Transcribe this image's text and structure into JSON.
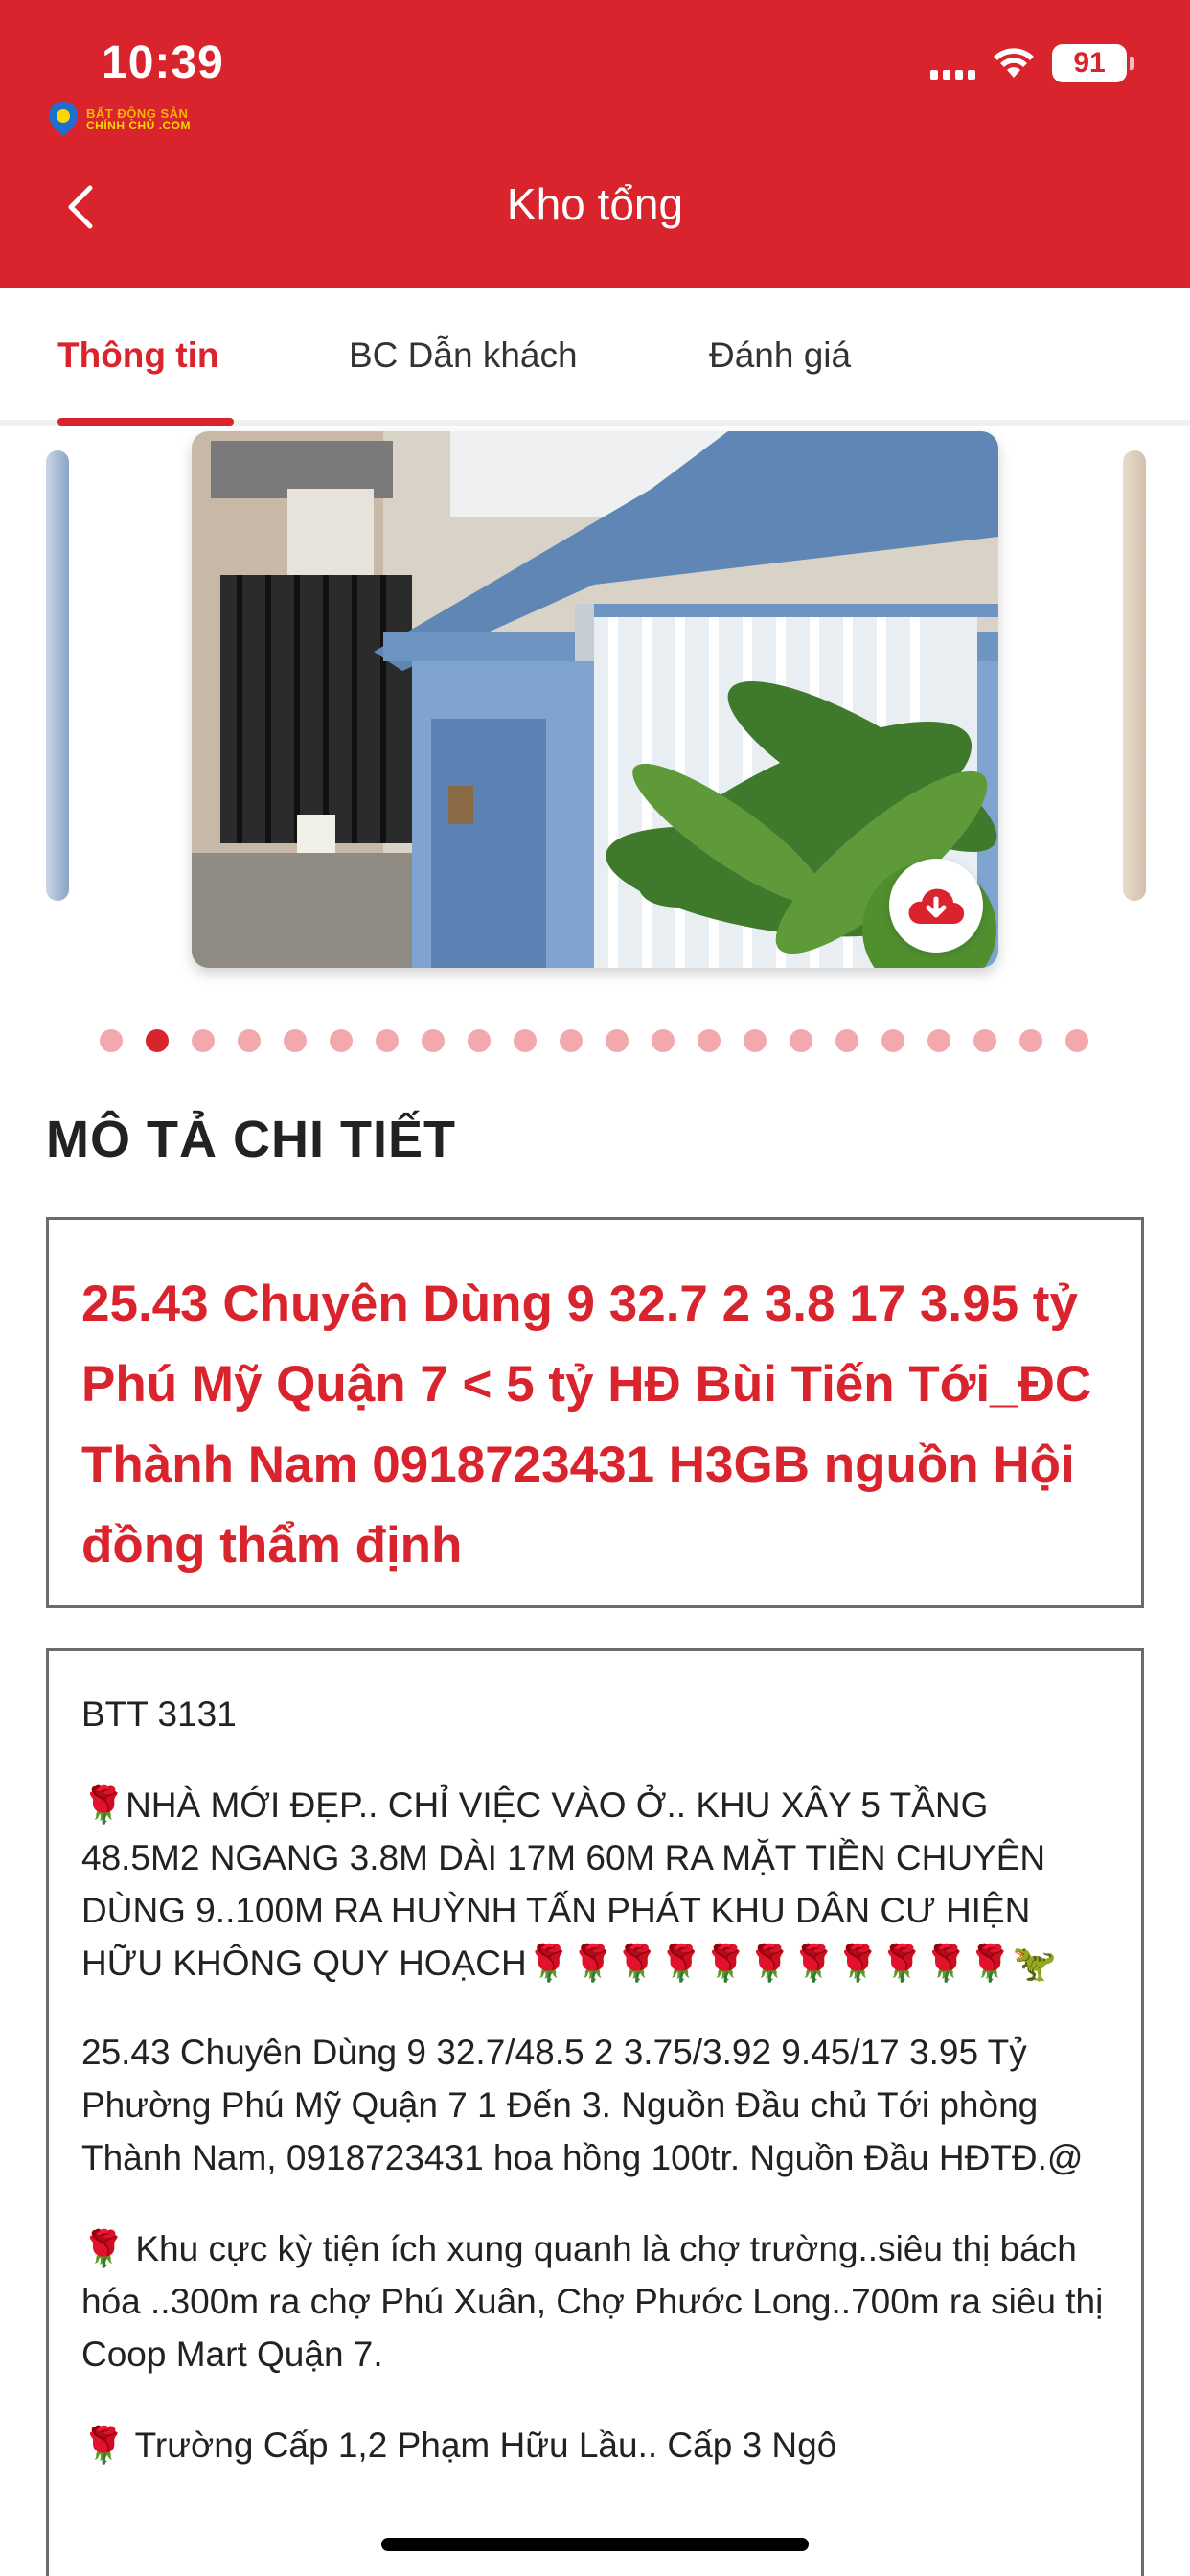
{
  "status_bar": {
    "time": "10:39",
    "battery": "91"
  },
  "logo": {
    "line1": "BẤT ĐỘNG SẢN",
    "line2": "CHÍNH CHỦ .COM"
  },
  "header": {
    "title": "Kho tổng"
  },
  "tabs": [
    {
      "label": "Thông tin",
      "active": true
    },
    {
      "label": "BC Dẫn khách",
      "active": false
    },
    {
      "label": "Đánh giá",
      "active": false
    }
  ],
  "carousel": {
    "total_images": 22,
    "active_index": 1
  },
  "section_title": "MÔ TẢ CHI TIẾT",
  "headline": "25.43 Chuyên Dùng 9 32.7 2 3.8 17 3.95 tỷ Phú Mỹ Quận 7 < 5 tỷ HĐ Bùi Tiến Tới_ĐC Thành Nam 0918723431 H3GB nguồn Hội đồng thẩm định",
  "details": {
    "code": "BTT 3131",
    "p1": "🌹NHÀ MỚI ĐẸP.. CHỈ VIỆC VÀO Ở.. KHU XÂY 5 TẦNG 48.5M2 NGANG 3.8M DÀI 17M 60M RA MẶT TIỀN CHUYÊN DÙNG 9..100M RA HUỲNH TẤN PHÁT KHU DÂN CƯ HIỆN HỮU KHÔNG QUY HOẠCH🌹🌹🌹🌹🌹🌹🌹🌹🌹🌹🌹🦖",
    "p2": "25.43 Chuyên Dùng 9 32.7/48.5 2 3.75/3.92 9.45/17 3.95 Tỷ Phường Phú Mỹ Quận 7 1 Đến 3. Nguồn Đầu chủ Tới phòng Thành Nam, 0918723431 hoa hồng 100tr. Nguồn Đầu HĐTĐ.@",
    "p3": "🌹 Khu cực kỳ tiện ích xung quanh là chợ trường..siêu thị bách hóa ..300m ra chợ Phú Xuân, Chợ Phước Long..700m ra siêu thị Coop Mart Quận 7.",
    "p4": "🌹 Trường Cấp 1,2 Phạm Hữu Lầu.. Cấp 3 Ngô"
  },
  "colors": {
    "primary": "#d9232d",
    "dot_inactive": "#f3a8ad"
  }
}
